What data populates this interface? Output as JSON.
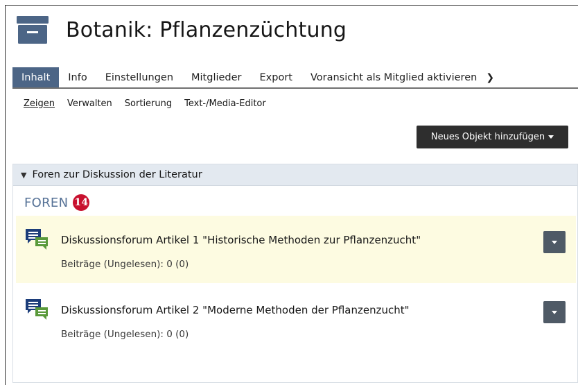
{
  "header": {
    "title": "Botanik: Pflanzenzüchtung",
    "icon": "folder-box-icon"
  },
  "tabs": [
    {
      "label": "Inhalt",
      "active": true
    },
    {
      "label": "Info"
    },
    {
      "label": "Einstellungen"
    },
    {
      "label": "Mitglieder"
    },
    {
      "label": "Export"
    },
    {
      "label": "Voransicht als Mitglied aktivieren"
    }
  ],
  "tab_more_icon": "chevron-right-icon",
  "subtabs": [
    {
      "label": "Zeigen",
      "active": true
    },
    {
      "label": "Verwalten"
    },
    {
      "label": "Sortierung"
    },
    {
      "label": "Text-/Media-Editor"
    }
  ],
  "toolbar": {
    "add_label": "Neues Objekt hinzufügen"
  },
  "block": {
    "header": "Foren zur Diskussion der Literatur",
    "section_title": "FOREN",
    "badge": "14",
    "items": [
      {
        "title": "Diskussionsforum Artikel 1 \"Historische Methoden zur Pflanzenzucht\"",
        "meta": "Beiträge (Ungelesen): 0 (0)",
        "highlighted": true,
        "icon": "forum-icon"
      },
      {
        "title": "Diskussionsforum Artikel 2 \"Moderne Methoden der Pflanzenzucht\"",
        "meta": "Beiträge (Ungelesen): 0 (0)",
        "highlighted": false,
        "icon": "forum-icon"
      }
    ]
  },
  "colors": {
    "tab_active_bg": "#4c6586",
    "button_bg": "#2e2e2e",
    "block_header_bg": "#e3e9f0",
    "section_title": "#557196",
    "badge_bg": "#c8102e",
    "highlight_bg": "#fdfbe1",
    "forum_icon_blue": "#1c3d7a",
    "forum_icon_green": "#5a9a3a"
  }
}
